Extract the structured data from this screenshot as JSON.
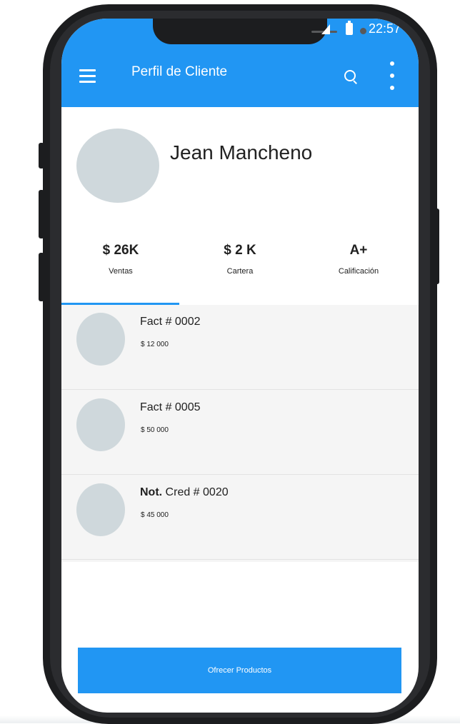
{
  "status_bar": {
    "time": "22:57"
  },
  "appbar": {
    "title": "Perfil de Cliente"
  },
  "profile": {
    "name": "Jean Mancheno"
  },
  "stats": [
    {
      "value": "$ 26K",
      "label": "Ventas"
    },
    {
      "value": "$ 2 K",
      "label": "Cartera"
    },
    {
      "value": "A+",
      "label": "Calificación"
    }
  ],
  "documents": [
    {
      "prefix": "",
      "title": "Fact # 0002",
      "amount": "$ 12 000"
    },
    {
      "prefix": "",
      "title": "Fact # 0005",
      "amount": "$ 50 000"
    },
    {
      "prefix": "Not.",
      "title": " Cred # 0020",
      "amount": "$ 45 000"
    }
  ],
  "actions": {
    "primary_label": "Ofrecer Productos"
  },
  "colors": {
    "primary": "#2196f3",
    "placeholder": "#cfd8dc",
    "list_background": "#f5f5f5"
  },
  "icons": [
    "menu-icon",
    "search-icon",
    "more-vert-icon",
    "signal-icon",
    "battery-icon"
  ]
}
